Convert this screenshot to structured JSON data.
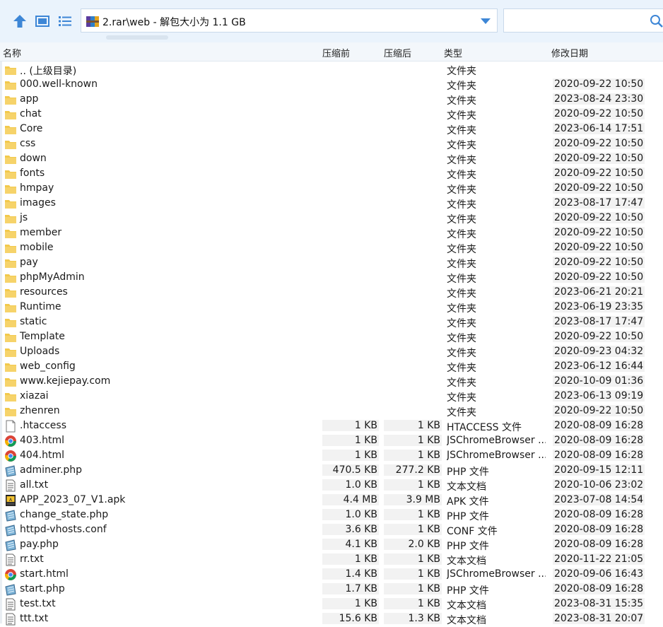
{
  "toolbar": {
    "address": "2.rar\\web - 解包大小为 1.1 GB",
    "search_placeholder": ""
  },
  "columns": {
    "name": "名称",
    "packed": "压缩前",
    "compressed": "压缩后",
    "type": "类型",
    "modified": "修改日期"
  },
  "rows": [
    {
      "name": ".. (上级目录)",
      "packed": "",
      "compressed": "",
      "type": "文件夹",
      "date": "",
      "icon": "folder-icon"
    },
    {
      "name": "000.well-known",
      "packed": "",
      "compressed": "",
      "type": "文件夹",
      "date": "2020-09-22 10:50",
      "icon": "folder-icon"
    },
    {
      "name": "app",
      "packed": "",
      "compressed": "",
      "type": "文件夹",
      "date": "2023-08-24 23:30",
      "icon": "folder-icon"
    },
    {
      "name": "chat",
      "packed": "",
      "compressed": "",
      "type": "文件夹",
      "date": "2020-09-22 10:50",
      "icon": "folder-icon"
    },
    {
      "name": "Core",
      "packed": "",
      "compressed": "",
      "type": "文件夹",
      "date": "2023-06-14 17:51",
      "icon": "folder-icon"
    },
    {
      "name": "css",
      "packed": "",
      "compressed": "",
      "type": "文件夹",
      "date": "2020-09-22 10:50",
      "icon": "folder-icon"
    },
    {
      "name": "down",
      "packed": "",
      "compressed": "",
      "type": "文件夹",
      "date": "2020-09-22 10:50",
      "icon": "folder-icon"
    },
    {
      "name": "fonts",
      "packed": "",
      "compressed": "",
      "type": "文件夹",
      "date": "2020-09-22 10:50",
      "icon": "folder-icon"
    },
    {
      "name": "hmpay",
      "packed": "",
      "compressed": "",
      "type": "文件夹",
      "date": "2020-09-22 10:50",
      "icon": "folder-icon"
    },
    {
      "name": "images",
      "packed": "",
      "compressed": "",
      "type": "文件夹",
      "date": "2023-08-17 17:47",
      "icon": "folder-icon"
    },
    {
      "name": "js",
      "packed": "",
      "compressed": "",
      "type": "文件夹",
      "date": "2020-09-22 10:50",
      "icon": "folder-icon"
    },
    {
      "name": "member",
      "packed": "",
      "compressed": "",
      "type": "文件夹",
      "date": "2020-09-22 10:50",
      "icon": "folder-icon"
    },
    {
      "name": "mobile",
      "packed": "",
      "compressed": "",
      "type": "文件夹",
      "date": "2020-09-22 10:50",
      "icon": "folder-icon"
    },
    {
      "name": "pay",
      "packed": "",
      "compressed": "",
      "type": "文件夹",
      "date": "2020-09-22 10:50",
      "icon": "folder-icon"
    },
    {
      "name": "phpMyAdmin",
      "packed": "",
      "compressed": "",
      "type": "文件夹",
      "date": "2020-09-22 10:50",
      "icon": "folder-icon"
    },
    {
      "name": "resources",
      "packed": "",
      "compressed": "",
      "type": "文件夹",
      "date": "2023-06-21 20:21",
      "icon": "folder-icon"
    },
    {
      "name": "Runtime",
      "packed": "",
      "compressed": "",
      "type": "文件夹",
      "date": "2023-06-19 23:35",
      "icon": "folder-icon"
    },
    {
      "name": "static",
      "packed": "",
      "compressed": "",
      "type": "文件夹",
      "date": "2023-08-17 17:47",
      "icon": "folder-icon"
    },
    {
      "name": "Template",
      "packed": "",
      "compressed": "",
      "type": "文件夹",
      "date": "2020-09-22 10:50",
      "icon": "folder-icon"
    },
    {
      "name": "Uploads",
      "packed": "",
      "compressed": "",
      "type": "文件夹",
      "date": "2020-09-23 04:32",
      "icon": "folder-icon"
    },
    {
      "name": "web_config",
      "packed": "",
      "compressed": "",
      "type": "文件夹",
      "date": "2023-06-12 16:44",
      "icon": "folder-icon"
    },
    {
      "name": "www.kejiepay.com",
      "packed": "",
      "compressed": "",
      "type": "文件夹",
      "date": "2020-10-09 01:36",
      "icon": "folder-icon"
    },
    {
      "name": "xiazai",
      "packed": "",
      "compressed": "",
      "type": "文件夹",
      "date": "2023-06-13 09:19",
      "icon": "folder-icon"
    },
    {
      "name": "zhenren",
      "packed": "",
      "compressed": "",
      "type": "文件夹",
      "date": "2020-09-22 10:50",
      "icon": "folder-icon"
    },
    {
      "name": ".htaccess",
      "packed": "1 KB",
      "compressed": "1 KB",
      "type": "HTACCESS 文件",
      "date": "2020-08-09 16:28",
      "icon": "blank-file-icon"
    },
    {
      "name": "403.html",
      "packed": "1 KB",
      "compressed": "1 KB",
      "type": "JSChromeBrowser ...",
      "date": "2020-08-09 16:28",
      "icon": "chrome-html-icon"
    },
    {
      "name": "404.html",
      "packed": "1 KB",
      "compressed": "1 KB",
      "type": "JSChromeBrowser ...",
      "date": "2020-08-09 16:28",
      "icon": "chrome-html-icon"
    },
    {
      "name": "adminer.php",
      "packed": "470.5 KB",
      "compressed": "277.2 KB",
      "type": "PHP 文件",
      "date": "2020-09-15 12:11",
      "icon": "php-file-icon"
    },
    {
      "name": "all.txt",
      "packed": "1.0 KB",
      "compressed": "1 KB",
      "type": "文本文档",
      "date": "2020-10-06 23:02",
      "icon": "text-file-icon"
    },
    {
      "name": "APP_2023_07_V1.apk",
      "packed": "4.4 MB",
      "compressed": "3.9 MB",
      "type": "APK 文件",
      "date": "2023-07-08 14:54",
      "icon": "apk-file-icon"
    },
    {
      "name": "change_state.php",
      "packed": "1.0 KB",
      "compressed": "1 KB",
      "type": "PHP 文件",
      "date": "2020-08-09 16:28",
      "icon": "php-file-icon"
    },
    {
      "name": "httpd-vhosts.conf",
      "packed": "3.6 KB",
      "compressed": "1 KB",
      "type": "CONF 文件",
      "date": "2020-08-09 16:28",
      "icon": "php-file-icon"
    },
    {
      "name": "pay.php",
      "packed": "4.1 KB",
      "compressed": "2.0 KB",
      "type": "PHP 文件",
      "date": "2020-08-09 16:28",
      "icon": "php-file-icon"
    },
    {
      "name": "rr.txt",
      "packed": "1 KB",
      "compressed": "1 KB",
      "type": "文本文档",
      "date": "2020-11-22 21:05",
      "icon": "text-file-icon"
    },
    {
      "name": "start.html",
      "packed": "1.4 KB",
      "compressed": "1 KB",
      "type": "JSChromeBrowser ...",
      "date": "2020-09-06 16:43",
      "icon": "chrome-html-icon"
    },
    {
      "name": "start.php",
      "packed": "1.7 KB",
      "compressed": "1 KB",
      "type": "PHP 文件",
      "date": "2020-08-09 16:28",
      "icon": "php-file-icon"
    },
    {
      "name": "test.txt",
      "packed": "1 KB",
      "compressed": "1 KB",
      "type": "文本文档",
      "date": "2023-08-31 15:35",
      "icon": "text-file-icon"
    },
    {
      "name": "ttt.txt",
      "packed": "15.6 KB",
      "compressed": "1.3 KB",
      "type": "文本文档",
      "date": "2023-08-31 20:07",
      "icon": "text-file-icon"
    }
  ]
}
